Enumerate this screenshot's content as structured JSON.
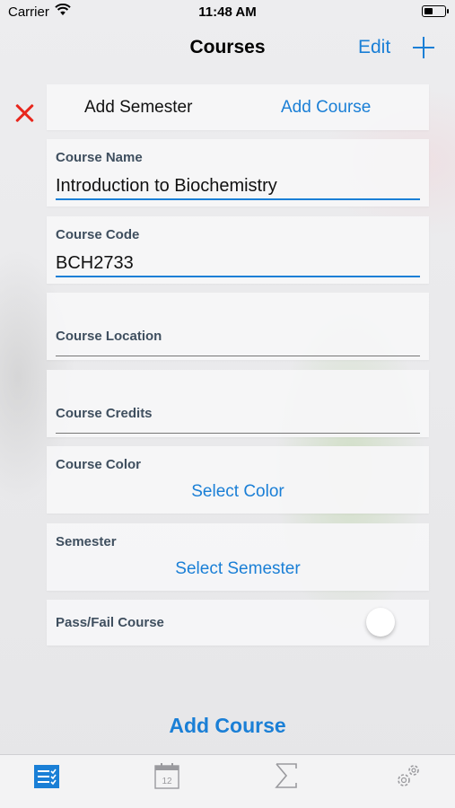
{
  "status_bar": {
    "carrier": "Carrier",
    "time": "11:48 AM"
  },
  "nav": {
    "title": "Courses",
    "edit_label": "Edit"
  },
  "segment": {
    "add_semester": "Add Semester",
    "add_course": "Add Course"
  },
  "form": {
    "course_name": {
      "label": "Course Name",
      "value": "Introduction to Biochemistry"
    },
    "course_code": {
      "label": "Course Code",
      "value": "BCH2733"
    },
    "course_location": {
      "label": "Course Location",
      "value": ""
    },
    "course_credits": {
      "label": "Course Credits",
      "value": ""
    },
    "course_color": {
      "label": "Course Color",
      "action": "Select Color"
    },
    "semester": {
      "label": "Semester",
      "action": "Select Semester"
    },
    "pass_fail": {
      "label": "Pass/Fail Course",
      "checked": false
    }
  },
  "submit_label": "Add Course",
  "tab_bar": {
    "items": [
      {
        "icon": "courses-list-icon",
        "selected": true
      },
      {
        "icon": "calendar-icon",
        "badge": "12",
        "selected": false
      },
      {
        "icon": "sigma-icon",
        "selected": false
      },
      {
        "icon": "gears-icon",
        "selected": false
      }
    ]
  },
  "colors": {
    "accent": "#1a7fd6",
    "close": "#e8271d"
  }
}
